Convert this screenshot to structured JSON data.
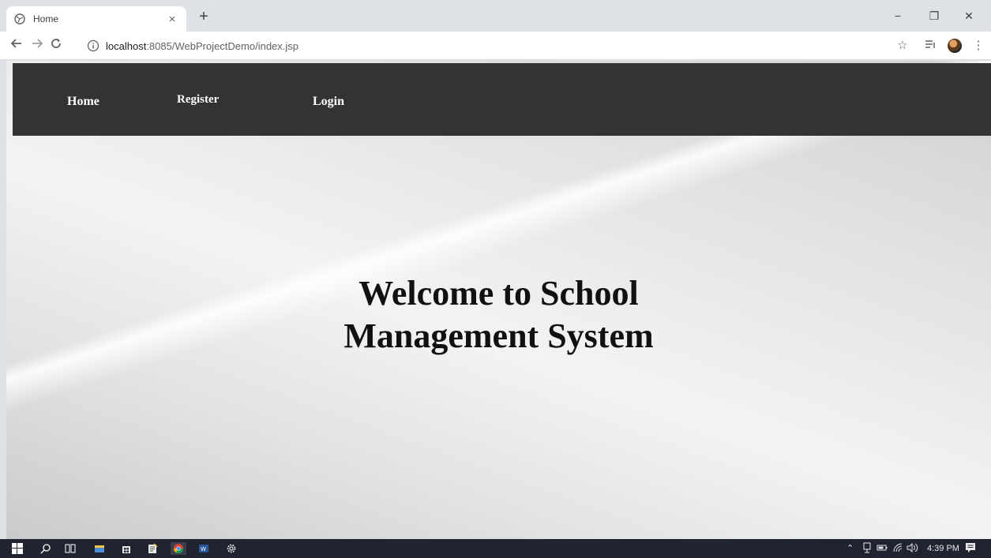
{
  "browser": {
    "tab_title": "Home",
    "tab_close": "×",
    "new_tab": "+",
    "url_host": "localhost",
    "url_rest": ":8085/WebProjectDemo/index.jsp",
    "window_controls": {
      "minimize": "−",
      "restore": "❐",
      "close": "✕"
    }
  },
  "navbar": {
    "items": [
      {
        "label": "Home"
      },
      {
        "label": "Register"
      },
      {
        "label": "Login"
      }
    ]
  },
  "hero": {
    "line1": "Welcome to School",
    "line2": "Management System"
  },
  "taskbar": {
    "time": "4:39 PM"
  },
  "colors": {
    "navbar_bg": "#333333",
    "taskbar_bg": "#1f2430"
  }
}
